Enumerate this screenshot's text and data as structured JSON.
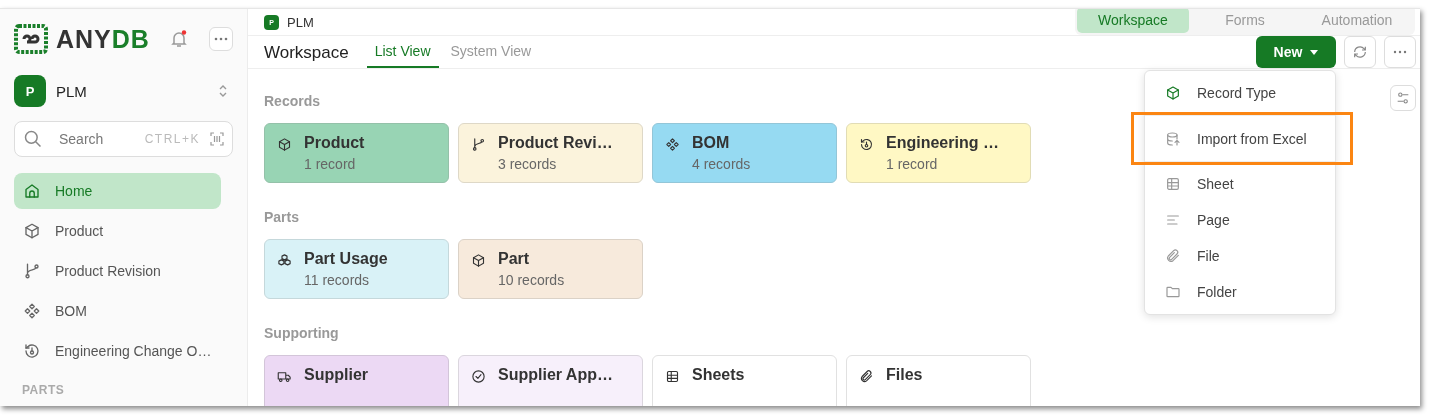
{
  "sidebar": {
    "logo": {
      "part_1": "ANY",
      "part_2": "DB"
    },
    "workspace": {
      "initial": "P",
      "name": "PLM"
    },
    "search": {
      "placeholder": "Search",
      "shortcut": "CTRL+K"
    },
    "items": [
      {
        "label": "Home",
        "selected": true
      },
      {
        "label": "Product",
        "selected": false
      },
      {
        "label": "Product Revision",
        "selected": false
      },
      {
        "label": "BOM",
        "selected": false
      },
      {
        "label": "Engineering Change O…",
        "selected": false
      }
    ],
    "section": "PARTS"
  },
  "breadcrumb": {
    "initial": "P",
    "label": "PLM"
  },
  "mode_tabs": [
    {
      "label": "Workspace",
      "selected": true
    },
    {
      "label": "Forms",
      "selected": false
    },
    {
      "label": "Automation",
      "selected": false
    }
  ],
  "header": {
    "title": "Workspace",
    "tabs": [
      {
        "label": "List View",
        "selected": true
      },
      {
        "label": "System View",
        "selected": false
      }
    ],
    "new_button": "New"
  },
  "groups": [
    {
      "title": "Records",
      "cards": [
        {
          "name": "Product",
          "count": "1 record",
          "color": "#98d4b4"
        },
        {
          "name": "Product Revi…",
          "count": "3 records",
          "color": "#fbf3dc"
        },
        {
          "name": "BOM",
          "count": "4 records",
          "color": "#96daf2"
        },
        {
          "name": "Engineering …",
          "count": "1 record",
          "color": "#fff8c4"
        }
      ]
    },
    {
      "title": "Parts",
      "cards": [
        {
          "name": "Part Usage",
          "count": "11 records",
          "color": "#d9f2f7"
        },
        {
          "name": "Part",
          "count": "10 records",
          "color": "#f7eadc"
        }
      ]
    },
    {
      "title": "Supporting",
      "cards": [
        {
          "name": "Supplier",
          "color": "#ecd9f4"
        },
        {
          "name": "Supplier App…",
          "color": "#f7f0fb"
        },
        {
          "name": "Sheets",
          "color": "#ffffff"
        },
        {
          "name": "Files",
          "color": "#ffffff"
        }
      ]
    }
  ],
  "new_menu": [
    {
      "label": "Record Type",
      "highlighted": false
    },
    {
      "label": "Import from Excel",
      "highlighted": true
    },
    {
      "label": "Sheet",
      "highlighted": false
    },
    {
      "label": "Page",
      "highlighted": false
    },
    {
      "label": "File",
      "highlighted": false
    },
    {
      "label": "Folder",
      "highlighted": false
    }
  ]
}
